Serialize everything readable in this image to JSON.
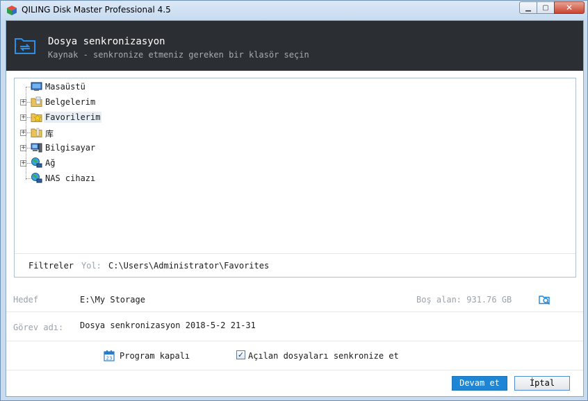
{
  "window": {
    "title": "QILING Disk Master Professional 4.5",
    "buttons": {
      "minimize": "▁",
      "restore": "▢",
      "close": "✕"
    }
  },
  "header": {
    "title": "Dosya senkronizasyon",
    "subtitle": "Kaynak - senkronize etmeniz gereken bir klasör seçin",
    "icon": "sync-folder-icon"
  },
  "tree": {
    "items": [
      {
        "label": "Masaüstü",
        "icon": "desktop-icon",
        "expandable": false
      },
      {
        "label": "Belgelerim",
        "icon": "documents-folder-icon",
        "expandable": true
      },
      {
        "label": "Favorilerim",
        "icon": "favorites-folder-icon",
        "expandable": true
      },
      {
        "label": "库",
        "icon": "library-folder-icon",
        "expandable": true
      },
      {
        "label": "Bilgisayar",
        "icon": "computer-icon",
        "expandable": true
      },
      {
        "label": "Ağ",
        "icon": "network-icon",
        "expandable": true
      },
      {
        "label": "NAS cihazı",
        "icon": "nas-device-icon",
        "expandable": false
      }
    ]
  },
  "filter": {
    "label": "Filtreler",
    "path_label": "Yol:",
    "path_value": "C:\\Users\\Administrator\\Favorites"
  },
  "target": {
    "label": "Hedef",
    "value": "E:\\My Storage",
    "free_space": "Boş alan: 931.76 GB"
  },
  "task": {
    "label": "Görev adı:",
    "value": "Dosya senkronizasyon 2018-5-2 21-31"
  },
  "options": {
    "program_label": "Program kapalı",
    "sync_open_files_label": "Açılan dosyaları senkronize et",
    "sync_open_files_checked": true,
    "check_mark": "✓"
  },
  "buttons": {
    "continue": "Devam et",
    "cancel": "İptal"
  },
  "colors": {
    "header_bg": "#2b2f33",
    "primary": "#1f86d6",
    "window_frame": "#c9dcef"
  }
}
